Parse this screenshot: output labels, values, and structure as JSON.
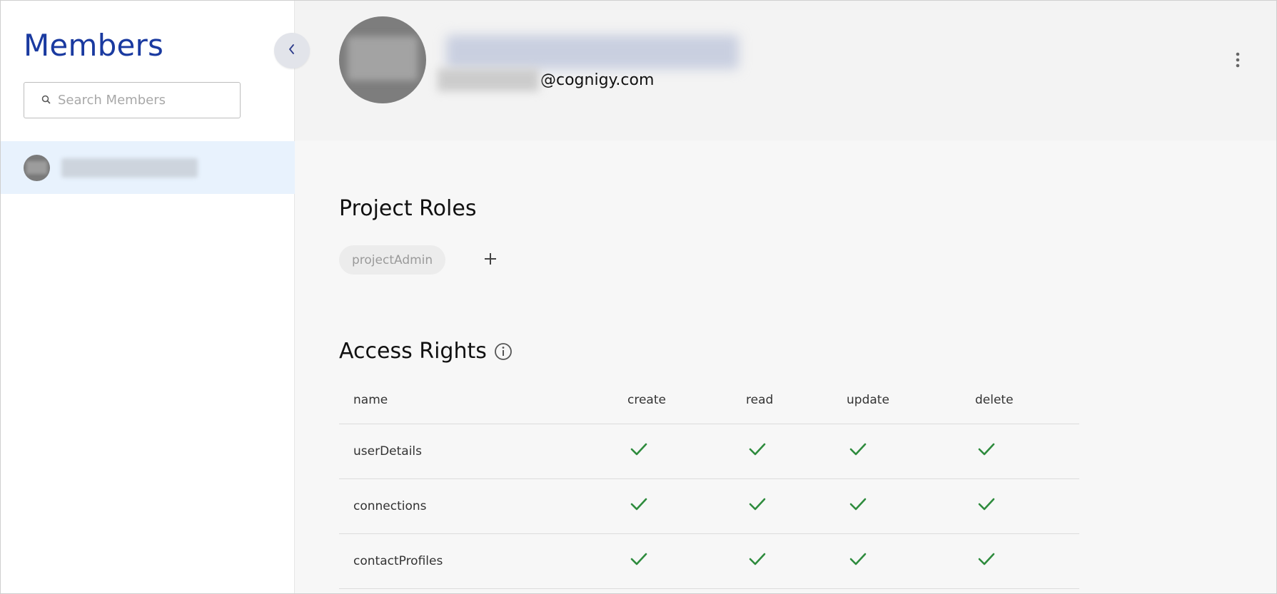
{
  "sidebar": {
    "title": "Members",
    "search_placeholder": "Search Members",
    "members": [
      {
        "name": ""
      }
    ]
  },
  "profile": {
    "email_domain": "@cognigy.com"
  },
  "roles": {
    "title": "Project Roles",
    "items": [
      "projectAdmin"
    ]
  },
  "access_rights": {
    "title": "Access Rights",
    "columns": [
      "name",
      "create",
      "read",
      "update",
      "delete"
    ],
    "rows": [
      {
        "name": "userDetails",
        "create": true,
        "read": true,
        "update": true,
        "delete": true
      },
      {
        "name": "connections",
        "create": true,
        "read": true,
        "update": true,
        "delete": true
      },
      {
        "name": "contactProfiles",
        "create": true,
        "read": true,
        "update": true,
        "delete": true
      }
    ]
  },
  "colors": {
    "accent": "#1a3aa0",
    "check": "#2e8b3d",
    "selected_row": "#e8f2fd"
  },
  "icons": {
    "collapse": "chevron-left-icon",
    "search": "search-icon",
    "more": "more-vertical-icon",
    "add": "plus-icon",
    "info": "info-icon",
    "check": "check-icon"
  }
}
